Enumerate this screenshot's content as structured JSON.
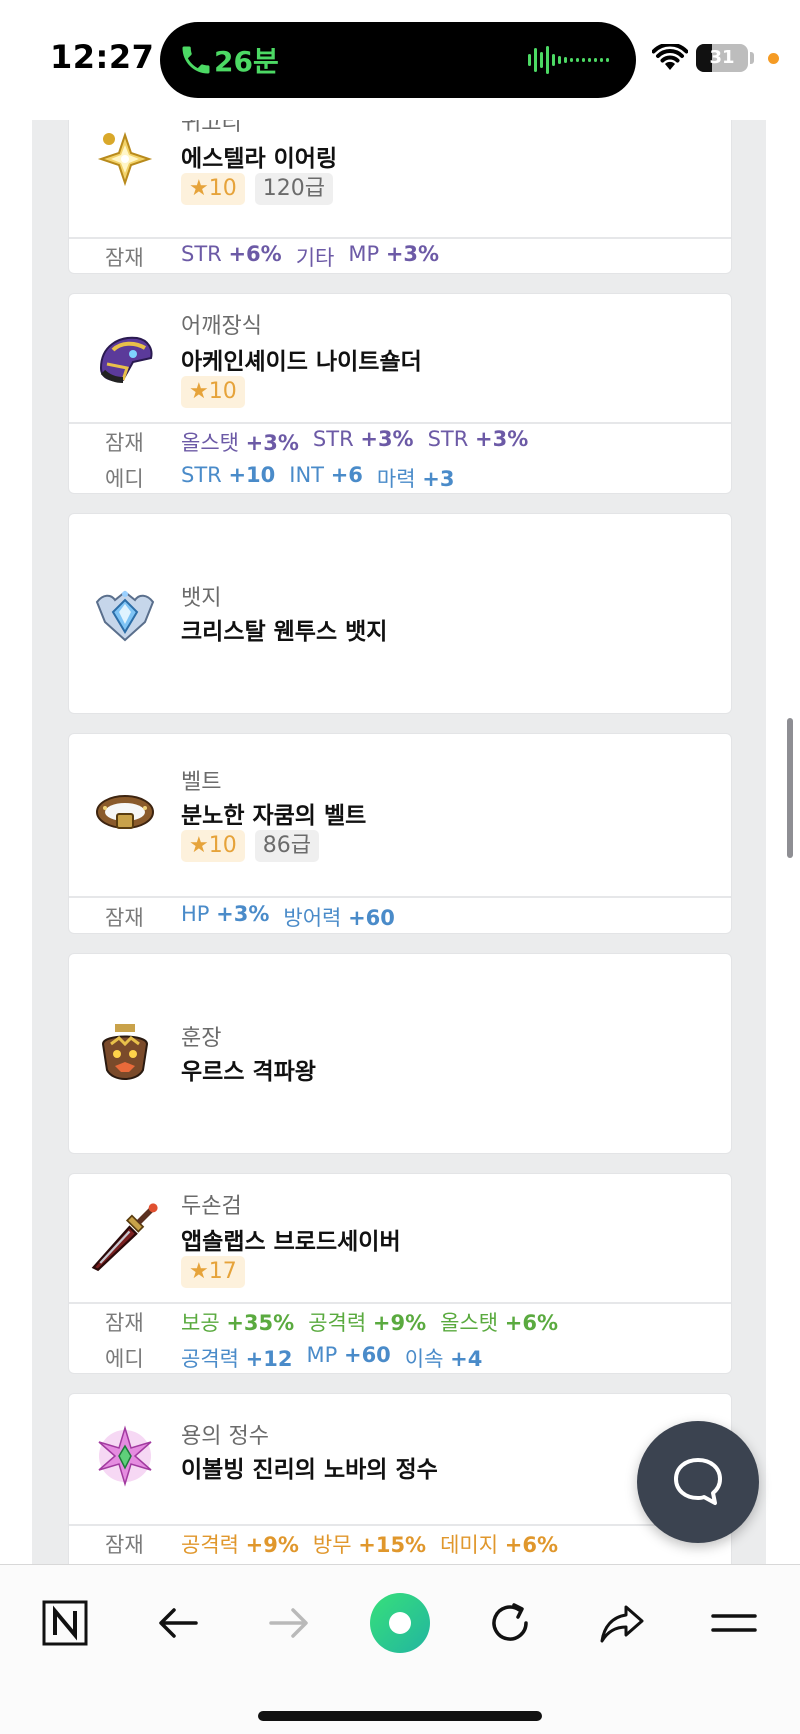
{
  "status_bar": {
    "time": "12:27",
    "call_duration": "26분",
    "battery_level": "31",
    "battery_percent": 31,
    "icons": [
      "phone-icon",
      "audio-wave-icon",
      "wifi-icon",
      "battery-icon"
    ]
  },
  "items": [
    {
      "category": "귀고리",
      "name": "에스텔라 이어링",
      "star": "★10",
      "grade": "120급",
      "icon": "earring-icon",
      "options": [
        {
          "label": "잠재",
          "color": "#6c5aa6",
          "stats": [
            {
              "stat": "STR",
              "value": "+6%"
            },
            {
              "stat": "기타",
              "value": ""
            },
            {
              "stat": "MP",
              "value": "+3%"
            }
          ]
        }
      ]
    },
    {
      "category": "어깨장식",
      "name": "아케인셰이드 나이트숄더",
      "star": "★10",
      "grade": "",
      "icon": "shoulder-icon",
      "options": [
        {
          "label": "잠재",
          "color": "#6c5aa6",
          "stats": [
            {
              "stat": "올스탯",
              "value": "+3%"
            },
            {
              "stat": "STR",
              "value": "+3%"
            },
            {
              "stat": "STR",
              "value": "+3%"
            }
          ]
        },
        {
          "label": "에디",
          "color": "#4a8bc9",
          "stats": [
            {
              "stat": "STR",
              "value": "+10"
            },
            {
              "stat": "INT",
              "value": "+6"
            },
            {
              "stat": "마력",
              "value": "+3"
            }
          ]
        }
      ]
    },
    {
      "category": "뱃지",
      "name": "크리스탈 웬투스 뱃지",
      "icon": "badge-icon",
      "options": []
    },
    {
      "category": "벨트",
      "name": "분노한 자쿰의 벨트",
      "star": "★10",
      "grade": "86급",
      "icon": "belt-icon",
      "options": [
        {
          "label": "잠재",
          "color": "#4a8bc9",
          "stats": [
            {
              "stat": "HP",
              "value": "+3%"
            },
            {
              "stat": "방어력",
              "value": "+60"
            }
          ]
        }
      ]
    },
    {
      "category": "훈장",
      "name": "우르스 격파왕",
      "icon": "medal-icon",
      "options": []
    },
    {
      "category": "두손검",
      "name": "앱솔랩스 브로드세이버",
      "star": "★17",
      "grade": "",
      "icon": "sword-icon",
      "options": [
        {
          "label": "잠재",
          "color": "#5aaa3f",
          "stats": [
            {
              "stat": "보공",
              "value": "+35%"
            },
            {
              "stat": "공격력",
              "value": "+9%"
            },
            {
              "stat": "올스탯",
              "value": "+6%"
            }
          ]
        },
        {
          "label": "에디",
          "color": "#4a8bc9",
          "stats": [
            {
              "stat": "공격력",
              "value": "+12"
            },
            {
              "stat": "MP",
              "value": "+60"
            },
            {
              "stat": "이속",
              "value": "+4"
            }
          ]
        }
      ]
    },
    {
      "category": "용의 정수",
      "name": "이볼빙 진리의 노바의 정수",
      "icon": "essence-icon",
      "options": [
        {
          "label": "잠재",
          "color": "#e0972c",
          "stats": [
            {
              "stat": "공격력",
              "value": "+9%"
            },
            {
              "stat": "방무",
              "value": "+15%"
            },
            {
              "stat": "데미지",
              "value": "+6%"
            }
          ]
        }
      ]
    }
  ],
  "toolbar": {
    "buttons": [
      "naver-home-icon",
      "back-icon",
      "forward-icon",
      "green-dot-icon",
      "refresh-icon",
      "share-icon",
      "menu-icon"
    ]
  }
}
